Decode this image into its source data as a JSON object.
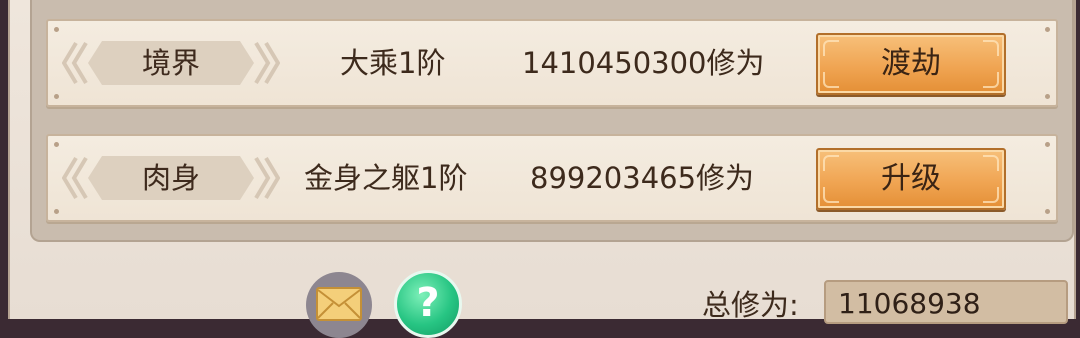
{
  "rows": [
    {
      "label": "境界",
      "level": "大乘1阶",
      "cost": "1410450300修为",
      "button": "渡劫"
    },
    {
      "label": "肉身",
      "level": "金身之躯1阶",
      "cost": "899203465修为",
      "button": "升级"
    }
  ],
  "footer": {
    "total_label": "总修为:",
    "total_value": "11068938",
    "help_glyph": "?"
  },
  "icons": {
    "mail": "mail-envelope-icon",
    "help": "help-question-icon",
    "ribbon": "chevron-ribbon-icon"
  },
  "colors": {
    "button_orange": "#f0a553",
    "panel_cream": "#f4ece0",
    "help_green": "#27c583"
  }
}
